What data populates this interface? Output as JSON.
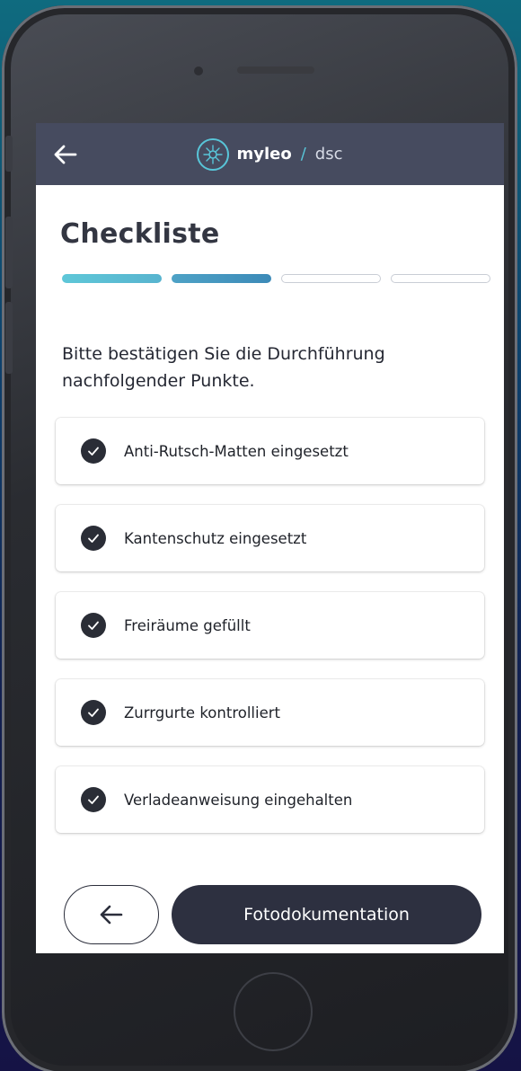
{
  "header": {
    "brand_name": "myleo",
    "brand_separator": "/",
    "brand_sub": "dsc",
    "back_icon": "arrow-left-icon",
    "logo_icon": "compass-logo-icon"
  },
  "page": {
    "title": "Checkliste",
    "progress": {
      "total_steps": 4,
      "completed_steps": 2
    },
    "intro": "Bitte bestätigen Sie die Durchführung nachfolgender Punkte."
  },
  "checklist": {
    "items": [
      {
        "label": "Anti-Rutsch-Matten eingesetzt",
        "checked": true
      },
      {
        "label": "Kantenschutz eingesetzt",
        "checked": true
      },
      {
        "label": "Freiräume gefüllt",
        "checked": true
      },
      {
        "label": "Zurrgurte kontrolliert",
        "checked": true
      },
      {
        "label": "Verladeanweisung eingehalten",
        "checked": true
      }
    ]
  },
  "footer": {
    "back_icon": "arrow-left-icon",
    "next_label": "Fotodokumentation"
  },
  "colors": {
    "topbar": "#464b5f",
    "accent": "#58c5d8",
    "dark": "#2d3040"
  }
}
